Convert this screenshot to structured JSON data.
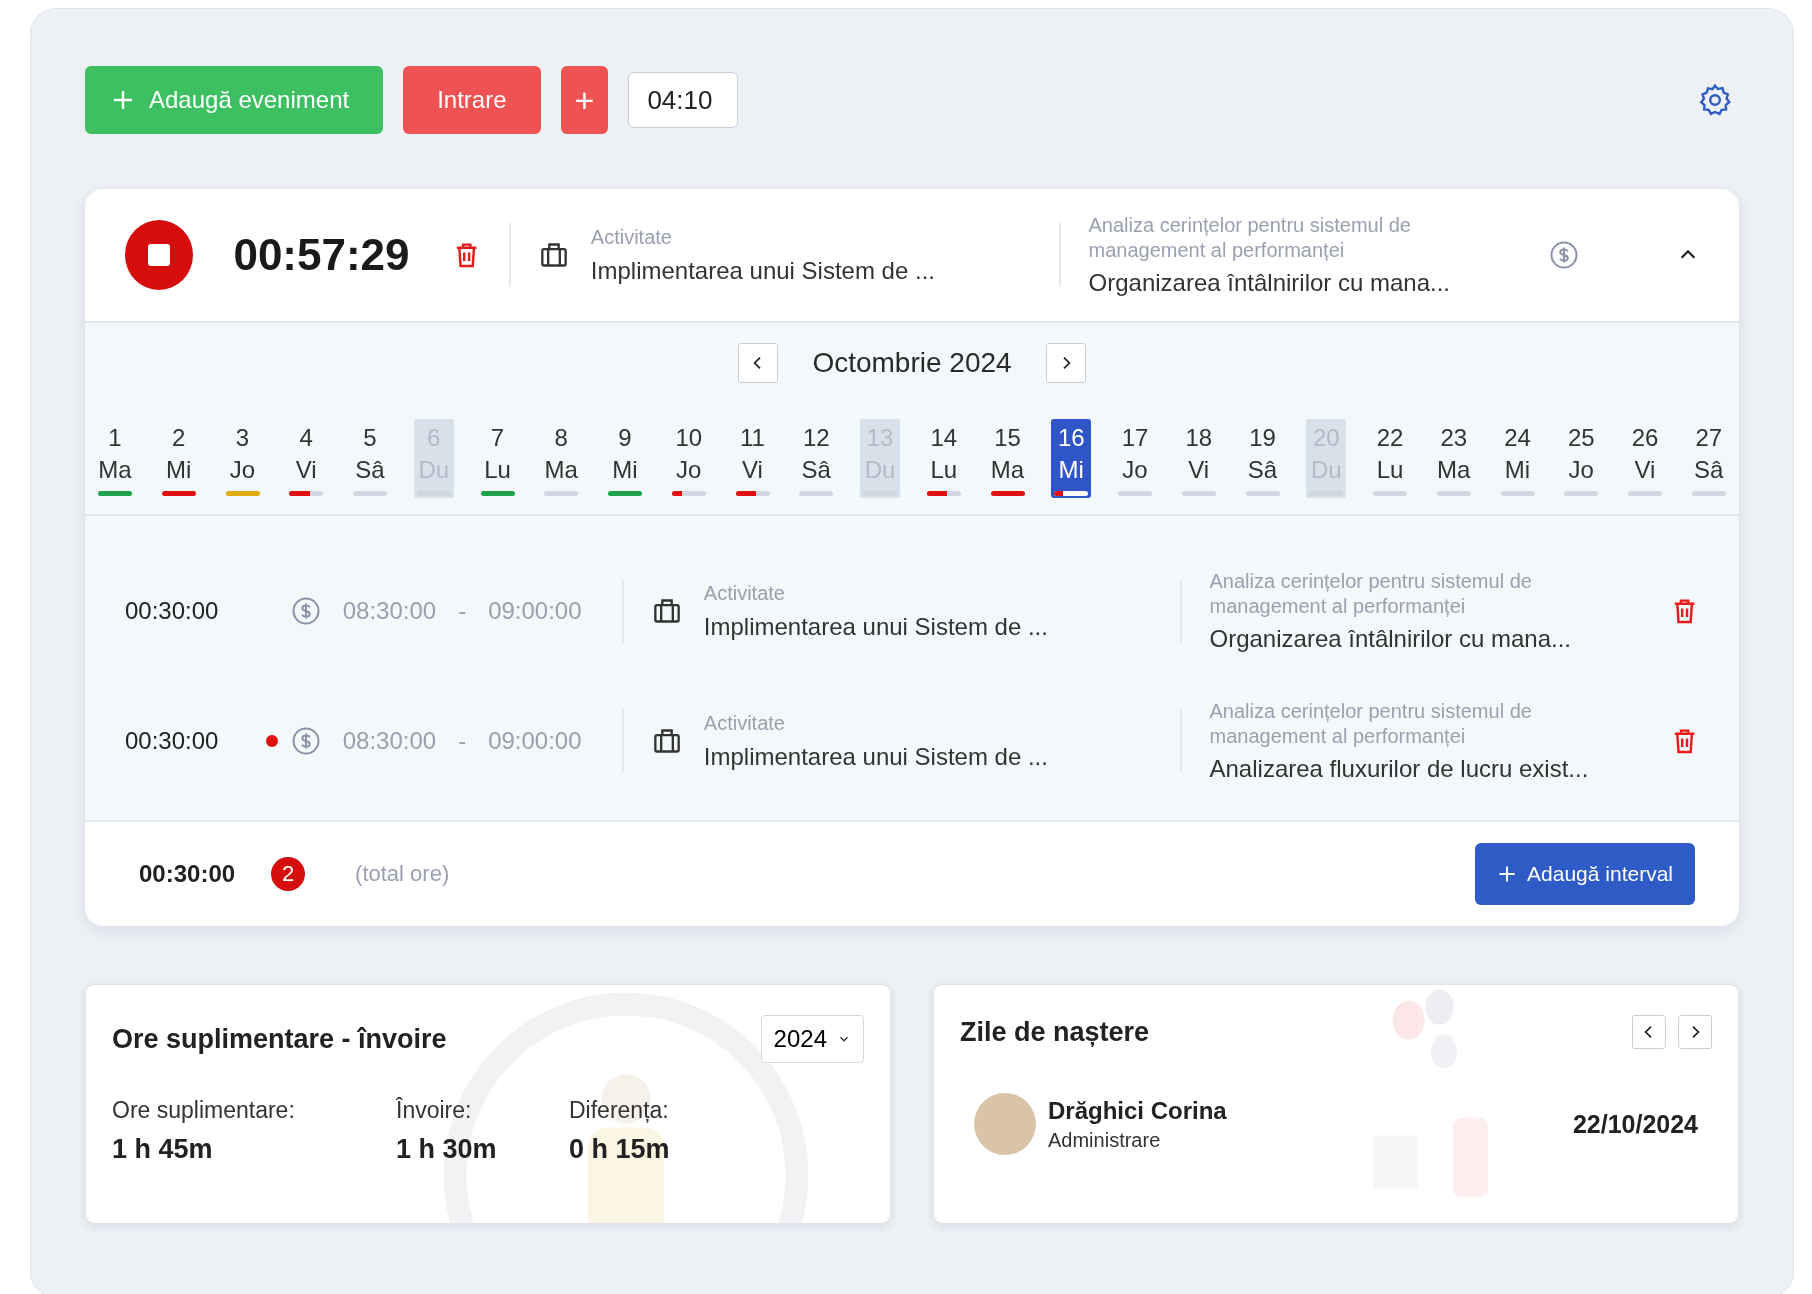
{
  "toolbar": {
    "buttons": [
      {
        "kind": "add",
        "label": "Adaugă eveniment"
      },
      {
        "kind": "entry",
        "label": "Intrare"
      },
      {
        "kind": "plus",
        "label": "+"
      }
    ],
    "time_value": "04:10"
  },
  "timer": {
    "running": true,
    "elapsed": "00:57:29",
    "activity_label": "Activitate",
    "activity": "Implimentarea unui Sistem de ...",
    "task_group": "Analiza cerințelor pentru sistemul de management al performanței",
    "task": "Organizarea întâlnirilor cu mana...",
    "expanded": true
  },
  "calendar": {
    "month": "Octombrie 2024",
    "days": [
      {
        "day": "1",
        "weekday": "Ma",
        "weekend": false,
        "selected": false,
        "level": 1,
        "color": "#1ea34a"
      },
      {
        "day": "2",
        "weekday": "Mi",
        "weekend": false,
        "selected": false,
        "level": 1,
        "color": "#e01010"
      },
      {
        "day": "3",
        "weekday": "Jo",
        "weekend": false,
        "selected": false,
        "level": 1,
        "color": "#e0ac10"
      },
      {
        "day": "4",
        "weekday": "Vi",
        "weekend": false,
        "selected": false,
        "level": 0.6,
        "color": "#e01010"
      },
      {
        "day": "5",
        "weekday": "Sâ",
        "weekend": false,
        "selected": false,
        "level": 0
      },
      {
        "day": "6",
        "weekday": "Du",
        "weekend": true,
        "selected": false,
        "level": 0
      },
      {
        "day": "7",
        "weekday": "Lu",
        "weekend": false,
        "selected": false,
        "level": 1,
        "color": "#1ea34a"
      },
      {
        "day": "8",
        "weekday": "Ma",
        "weekend": false,
        "selected": false,
        "level": 0
      },
      {
        "day": "9",
        "weekday": "Mi",
        "weekend": false,
        "selected": false,
        "level": 1,
        "color": "#1ea34a"
      },
      {
        "day": "10",
        "weekday": "Jo",
        "weekend": false,
        "selected": false,
        "level": 0.3,
        "color": "#e01010"
      },
      {
        "day": "11",
        "weekday": "Vi",
        "weekend": false,
        "selected": false,
        "level": 0.6,
        "color": "#e01010"
      },
      {
        "day": "12",
        "weekday": "Sâ",
        "weekend": false,
        "selected": false,
        "level": 0
      },
      {
        "day": "13",
        "weekday": "Du",
        "weekend": true,
        "selected": false,
        "level": 0
      },
      {
        "day": "14",
        "weekday": "Lu",
        "weekend": false,
        "selected": false,
        "level": 0.6,
        "color": "#e01010"
      },
      {
        "day": "15",
        "weekday": "Ma",
        "weekend": false,
        "selected": false,
        "level": 1,
        "color": "#e01010"
      },
      {
        "day": "16",
        "weekday": "Mi",
        "weekend": false,
        "selected": true,
        "level": 0.25,
        "color": "#e01010"
      },
      {
        "day": "17",
        "weekday": "Jo",
        "weekend": false,
        "selected": false,
        "level": 0
      },
      {
        "day": "18",
        "weekday": "Vi",
        "weekend": false,
        "selected": false,
        "level": 0
      },
      {
        "day": "19",
        "weekday": "Sâ",
        "weekend": false,
        "selected": false,
        "level": 0
      },
      {
        "day": "20",
        "weekday": "Du",
        "weekend": true,
        "selected": false,
        "level": 0
      },
      {
        "day": "22",
        "weekday": "Lu",
        "weekend": false,
        "selected": false,
        "level": 0
      },
      {
        "day": "23",
        "weekday": "Ma",
        "weekend": false,
        "selected": false,
        "level": 0
      },
      {
        "day": "24",
        "weekday": "Mi",
        "weekend": false,
        "selected": false,
        "level": 0
      },
      {
        "day": "25",
        "weekday": "Jo",
        "weekend": false,
        "selected": false,
        "level": 0
      },
      {
        "day": "26",
        "weekday": "Vi",
        "weekend": false,
        "selected": false,
        "level": 0
      },
      {
        "day": "27",
        "weekday": "Sâ",
        "weekend": false,
        "selected": false,
        "level": 0
      }
    ]
  },
  "entries": [
    {
      "duration": "00:30:00",
      "flagged": false,
      "start": "08:30:00",
      "separator": "-",
      "end": "09:00:00",
      "activity_label": "Activitate",
      "activity": "Implimentarea unui Sistem de ...",
      "task_group": "Analiza cerințelor pentru sistemul de management al performanței",
      "task": "Organizarea întâlnirilor cu mana..."
    },
    {
      "duration": "00:30:00",
      "flagged": true,
      "start": "08:30:00",
      "separator": "-",
      "end": "09:00:00",
      "activity_label": "Activitate",
      "activity": "Implimentarea unui Sistem de ...",
      "task_group": "Analiza cerințelor pentru sistemul de management al performanței",
      "task": "Analizarea fluxurilor de lucru exist..."
    }
  ],
  "footer": {
    "total": "00:30:00",
    "count": "2",
    "note": "(total ore)",
    "button": "Adaugă interval"
  },
  "overtime": {
    "title": "Ore suplimentare - învoire",
    "year": "2024",
    "stats": [
      {
        "label": "Ore suplimentare:",
        "value": "1 h 45m"
      },
      {
        "label": "Învoire:",
        "value": "1 h 30m"
      },
      {
        "label": "Diferența:",
        "value": "0 h 15m"
      }
    ]
  },
  "birthdays": {
    "title": "Zile de naștere",
    "people": [
      {
        "name": "Drăghici Corina",
        "department": "Administrare",
        "date": "22/10/2024"
      }
    ]
  }
}
